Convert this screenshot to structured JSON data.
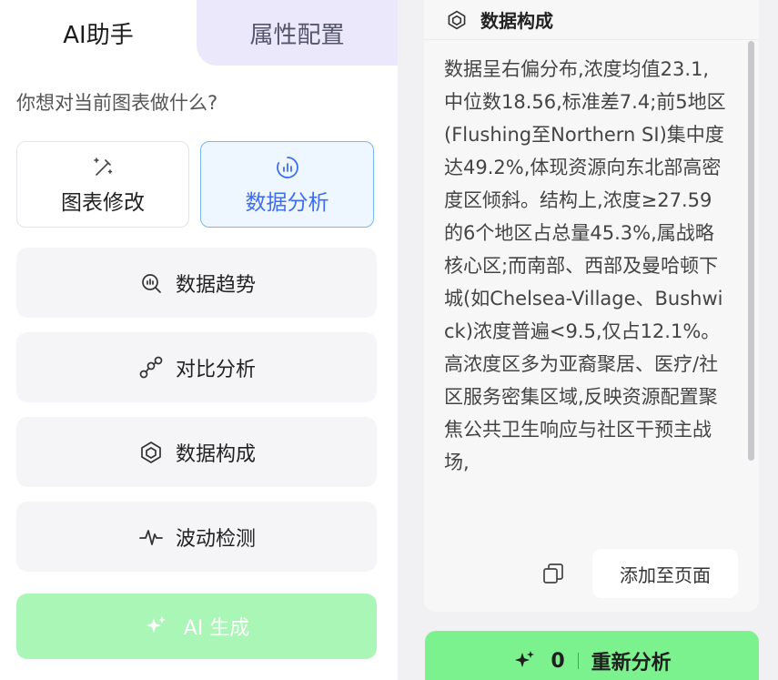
{
  "tabs": {
    "ai_assistant": "AI助手",
    "property_config": "属性配置"
  },
  "prompt": {
    "question": "你想对当前图表做什么?"
  },
  "modes": {
    "chart_edit": {
      "label": "图表修改",
      "icon": "magic-wand-icon"
    },
    "data_analysis": {
      "label": "数据分析",
      "icon": "analysis-chart-icon"
    }
  },
  "options": [
    {
      "label": "数据趋势",
      "icon": "trend-search-icon"
    },
    {
      "label": "对比分析",
      "icon": "compare-nodes-icon"
    },
    {
      "label": "数据构成",
      "icon": "composition-icon"
    },
    {
      "label": "波动检测",
      "icon": "pulse-wave-icon"
    }
  ],
  "generate": {
    "label": "AI 生成",
    "icon": "sparkle-icon"
  },
  "result": {
    "title": "数据构成",
    "text": "数据呈右偏分布,浓度均值23.1,中位数18.56,标准差7.4;前5地区(Flushing至Northern SI)集中度达49.2%,体现资源向东北部高密度区倾斜。结构上,浓度≥27.59的6个地区占总量45.3%,属战略核心区;而南部、西部及曼哈顿下城(如Chelsea-Village、Bushwick)浓度普遍<9.5,仅占12.1%。高浓度区多为亚裔聚居、医疗/社区服务密集区域,反映资源配置聚焦公共卫生响应与社区干预主战场,",
    "add_to_page": "添加至页面"
  },
  "reanalyze": {
    "count": "0",
    "label": "重新分析"
  },
  "colors": {
    "accent_blue": "#3f6df0",
    "tab_inactive_bg": "#ebe8fb",
    "generate_disabled": "#a9f6b6",
    "reanalyze_green": "#7cf28e"
  }
}
